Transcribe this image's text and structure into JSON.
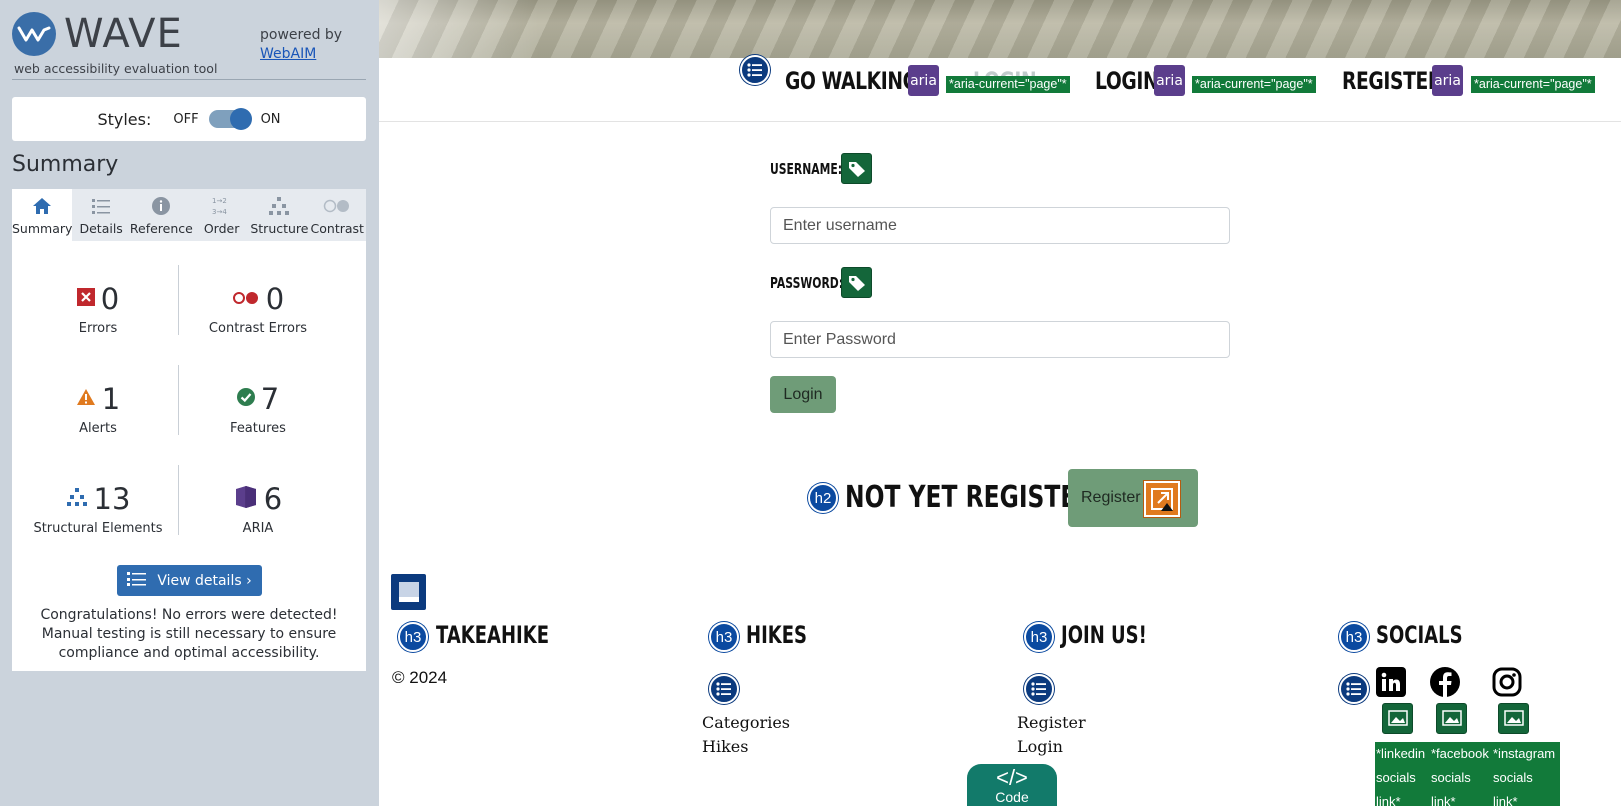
{
  "wave": {
    "brand_name": "WAVE",
    "tagline": "web accessibility evaluation tool",
    "powered_by": "powered by",
    "webaim_link": "WebAIM",
    "styles_label": "Styles:",
    "styles_off": "OFF",
    "styles_on": "ON",
    "summary_heading": "Summary",
    "tabs": [
      {
        "label": "Summary",
        "icon": "home-icon"
      },
      {
        "label": "Details",
        "icon": "list-icon"
      },
      {
        "label": "Reference",
        "icon": "info-icon"
      },
      {
        "label": "Order",
        "icon": "order-icon"
      },
      {
        "label": "Structure",
        "icon": "structure-icon"
      },
      {
        "label": "Contrast",
        "icon": "contrast-icon"
      }
    ],
    "stats": {
      "errors": {
        "value": "0",
        "label": "Errors"
      },
      "contrast_errors": {
        "value": "0",
        "label": "Contrast Errors"
      },
      "alerts": {
        "value": "1",
        "label": "Alerts"
      },
      "features": {
        "value": "7",
        "label": "Features"
      },
      "structural": {
        "value": "13",
        "label": "Structural Elements"
      },
      "aria": {
        "value": "6",
        "label": "ARIA"
      }
    },
    "view_details": "View details ›",
    "congrats": "Congratulations! No errors were detected! Manual testing is still necessary to ensure compliance and optimal accessibility."
  },
  "page": {
    "nav": {
      "go_walking": "GO WALKING!",
      "login_hidden": "LOGIN",
      "login": "LOGIN",
      "register": "REGISTER",
      "aria_icon": "aria",
      "aria_current": "*aria-current=\"page\"*"
    },
    "form": {
      "username_label": "USERNAME:",
      "username_placeholder": "Enter username",
      "password_label": "PASSWORD:",
      "password_placeholder": "Enter Password",
      "login_button": "Login"
    },
    "not_registered": "NOT YET REGISTERED?",
    "register_button": "Register",
    "h2_badge": "h2",
    "h3_badge": "h3",
    "footer": {
      "col1_title": "TAKEAHIKE",
      "copyright": "© 2024",
      "col2_title": "HIKES",
      "col2_links": [
        "Categories",
        "Hikes"
      ],
      "col3_title": "JOIN US!",
      "col3_links": [
        "Register",
        "Login"
      ],
      "col4_title": "SOCIALS",
      "social_alts": [
        [
          "*linkedin",
          "socials",
          "link*"
        ],
        [
          "*facebook",
          "socials",
          "link*"
        ],
        [
          "*instagram",
          "socials",
          "link*"
        ]
      ]
    },
    "code_tab": "Code"
  },
  "colors": {
    "wave_blue": "#2f6cb0",
    "aria_purple": "#5b3e8c",
    "feature_green": "#127a3a",
    "button_green": "#6f9c78",
    "alert_orange": "#e07a1f",
    "error_red": "#c0282d"
  }
}
